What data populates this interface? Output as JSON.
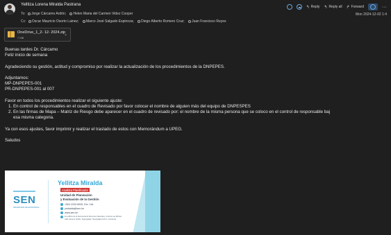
{
  "header": {
    "sender": "Yellitza Lorena Miralda Pastrana",
    "to_label": "To:",
    "to": [
      "Jorge Cárcamo Ardón;",
      "Helen Maria del Carmen Videz Cooper"
    ],
    "cc_label": "Cc:",
    "cc": [
      "Oscar Mauricio Osorto Lainez;",
      "Marco José Salgado Espinoza;",
      "Diego Alberto Romero Cruz;",
      "Juan Francisco Reyes"
    ],
    "date": "Mon 2024-12-02 1:4",
    "actions": {
      "reply": "Reply",
      "reply_all": "Reply all",
      "forward": "Forward",
      "more": "···"
    }
  },
  "attachment": {
    "name": "OneDrive_1_2- 12- 2024.zip",
    "size": "7 MB"
  },
  "body": {
    "greeting1": "Buenas tardes Dr. Cárcamo",
    "greeting2": "Feliz inicio de semana",
    "thanks": "Agradeciendo su gestión, actitud y compromiso por realizar la actualización de los procedimientos de la DNPEPES.",
    "attached_label": "Adjuntamos:",
    "attached1": "MP-DNPEPES-001",
    "attached2": "PR-DNPEPES-001 al 007",
    "request": "Favor en todos los procedimientos realizar el siguiente ajuste:",
    "item1_num": "1.",
    "item1": "En control de responsables en el cuadro de Revisado por favor colocar el nombre de alguien más del equipo de DNPESPES",
    "item2_num": "2.",
    "item2a": "En las firmas de Mapa – Matriz de Riesgo debe aparecer en el cuadro de revisado por: el nombre de la misma persona que se coloco en el control de responsable baj",
    "item2b": "esa misma categoria.",
    "closing": "Ya con esos ajustes, favor imprimir y realizar el traslado de estos con Memorándum a UPEG.",
    "sign": "Saludos"
  },
  "signature": {
    "logo": "SEN",
    "logo_sub": "SECRETARÍA DE ESTRATEGIA",
    "name": "Yellitza Miralda",
    "role": "Analista Planificador",
    "unit1": "Unidad de Planeación",
    "unit2": "y Evaluación de la Gestión",
    "phone": "+504 2232-6930, Ext. 116",
    "email": "ymiralda@sen.hn",
    "web": "www.sen.hn",
    "address1": "Ex edificio de la Secretaría de Recursos Naturales, Colonia Las Minitas",
    "address2": "calle hacia la UNAH, Tegucigalpa, Tegucigalpa M.D.C. Honduras"
  }
}
